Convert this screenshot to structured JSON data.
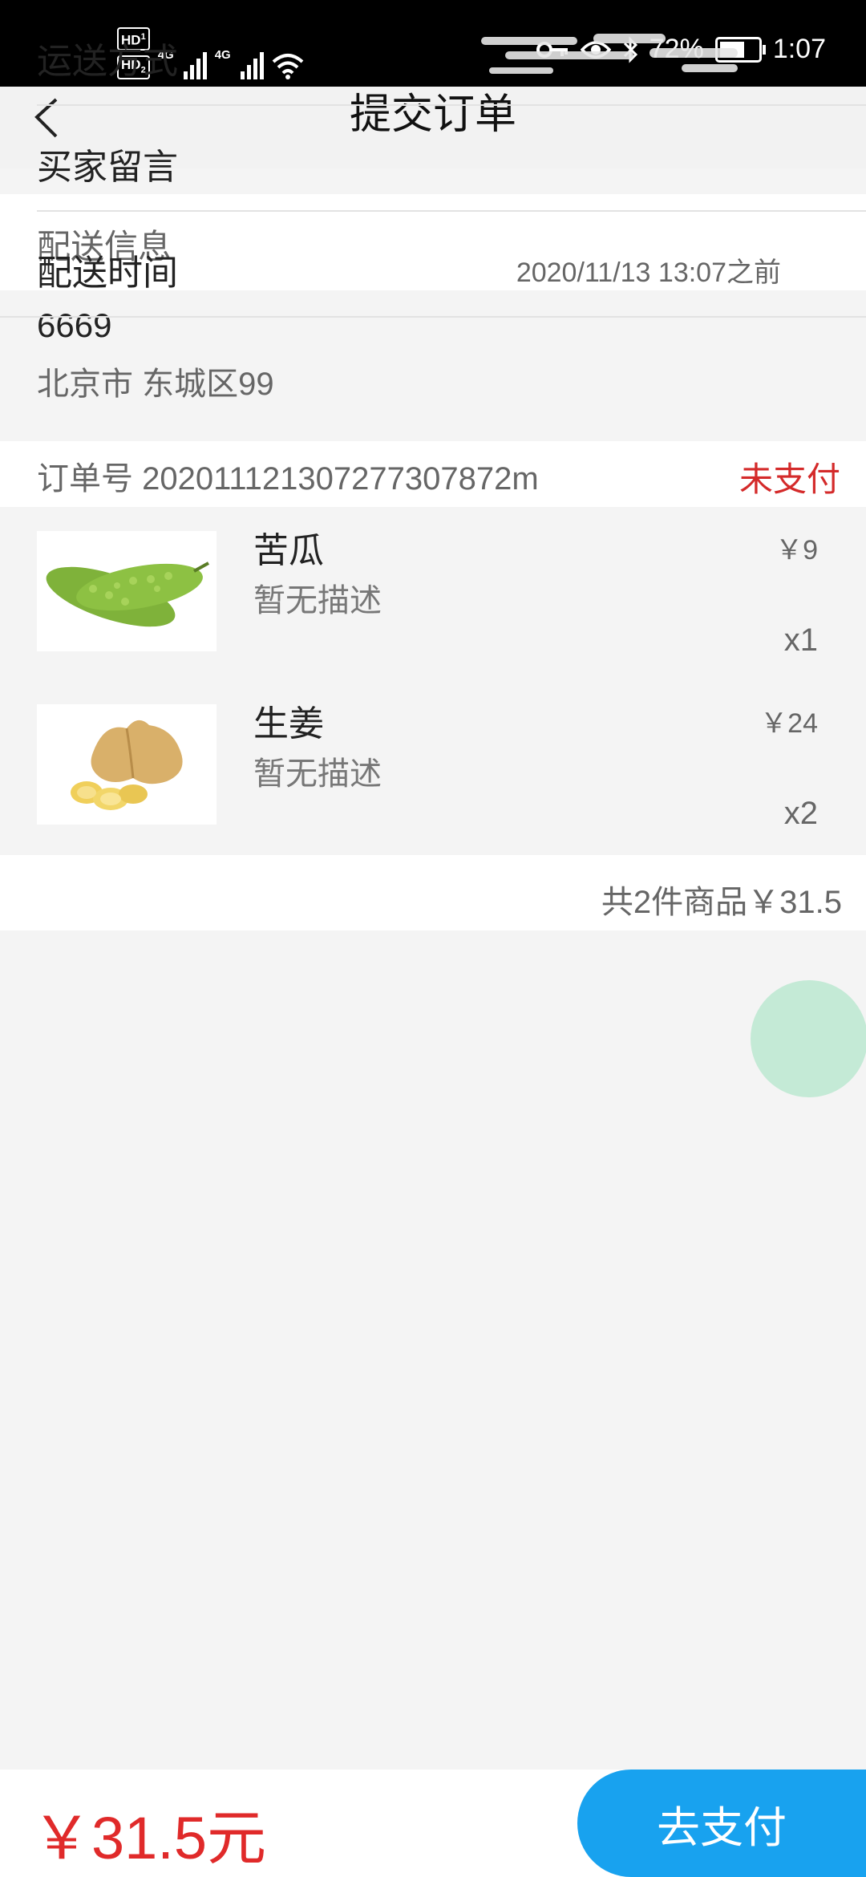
{
  "status_bar": {
    "hd1": "HD",
    "hd1_sub": "1",
    "hd2": "HD",
    "hd2_sub": "2",
    "network1": "4G",
    "network2": "4G",
    "battery": "72%",
    "battery_level": 0.72,
    "time": "1:07",
    "icons": [
      "key-icon",
      "eye-icon",
      "bluetooth-icon",
      "battery-icon",
      "wifi-icon",
      "signal-icon"
    ]
  },
  "header": {
    "title": "提交订单",
    "back_icon": "chevron-left-icon"
  },
  "delivery": {
    "section_label": "配送信息",
    "name": "6669",
    "address": "北京市 东城区99"
  },
  "order": {
    "number_label": "订单号",
    "number": "202011121307277307872m",
    "status": "未支付",
    "status_color": "#d42a2a",
    "items": [
      {
        "name": "苦瓜",
        "description": "暂无描述",
        "price": "￥9",
        "qty": "x1",
        "image": "bitter-melon"
      },
      {
        "name": "生姜",
        "description": "暂无描述",
        "price": "￥24",
        "qty": "x2",
        "image": "ginger"
      }
    ],
    "summary": "共2件商品￥31.5"
  },
  "options": [
    {
      "label": "运送方式",
      "value": ""
    },
    {
      "label": "买家留言",
      "value": ""
    },
    {
      "label": "配送时间",
      "value": "2020/11/13 13:07之前"
    }
  ],
  "footer": {
    "total": "￥31.5元",
    "pay_label": "去支付",
    "accent": "#18a2ef",
    "price_color": "#e02a2a"
  }
}
